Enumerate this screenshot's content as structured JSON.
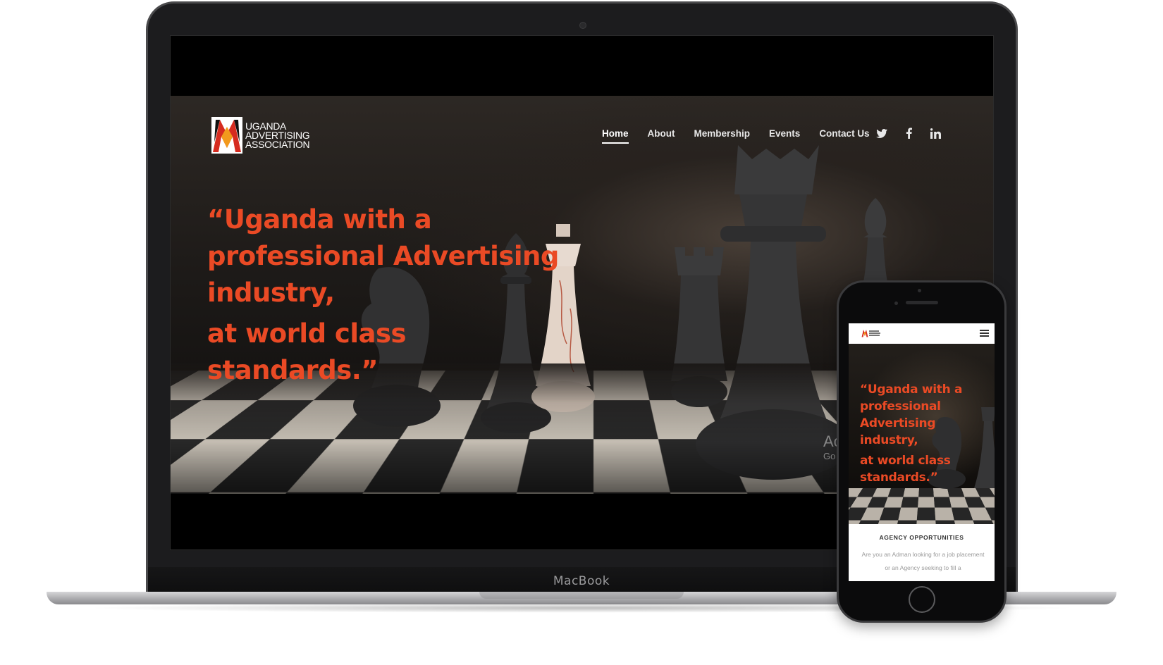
{
  "device_labels": {
    "laptop_brand": "MacBook"
  },
  "site": {
    "logo_text": [
      "UGANDA",
      "ADVERTISING",
      "ASSOCIATION"
    ],
    "brand_colors": {
      "accent": "#ea4a25",
      "logo_red": "#d62b1f",
      "logo_orange": "#f29a1d"
    },
    "nav": [
      {
        "label": "Home",
        "active": true
      },
      {
        "label": "About",
        "active": false
      },
      {
        "label": "Membership",
        "active": false
      },
      {
        "label": "Events",
        "active": false
      },
      {
        "label": "Contact Us",
        "active": false
      }
    ],
    "social_icons": [
      "twitter-icon",
      "facebook-icon",
      "linkedin-icon"
    ],
    "hero": {
      "quote_part1_lines": [
        "“Uganda with a",
        "professional Advertising",
        "industry,"
      ],
      "quote_part2_lines": [
        "at world class",
        "standards.”"
      ],
      "caption_title": "Ac",
      "caption_sub": "Go"
    }
  },
  "mobile": {
    "menu_icon": "hamburger-menu-icon",
    "quote_part1_lines": [
      "“Uganda with a",
      "professional",
      "Advertising",
      "industry,"
    ],
    "quote_part2_lines": [
      "at world class",
      "standards.”"
    ],
    "section_title": "AGENCY OPPORTUNITIES",
    "section_text": "Are you an Adman looking for a job placement or an Agency seeking to fill a"
  }
}
